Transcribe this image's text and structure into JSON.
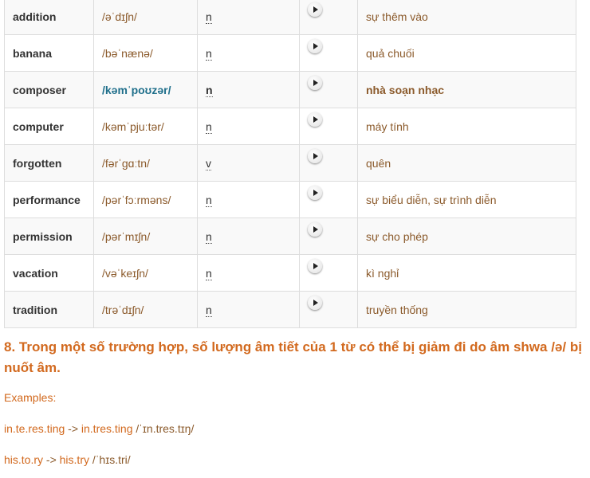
{
  "vocab_rows": [
    {
      "word": "addition",
      "ipa": "/əˈdɪʃn/",
      "pos": "n",
      "meaning": "sự thêm vào"
    },
    {
      "word": "banana",
      "ipa": "/bəˈnænə/",
      "pos": "n",
      "meaning": "quả chuối"
    },
    {
      "word": "composer",
      "ipa": "/kəmˈpoʊzər/",
      "pos": "n",
      "meaning": "nhà soạn nhạc"
    },
    {
      "word": "computer",
      "ipa": "/kəmˈpjuːtər/",
      "pos": "n",
      "meaning": "máy tính"
    },
    {
      "word": "forgotten",
      "ipa": "/fərˈɡɑːtn/",
      "pos": "v",
      "meaning": "quên"
    },
    {
      "word": "performance",
      "ipa": "/pərˈfɔːrməns/",
      "pos": "n",
      "meaning": "sự biểu diễn, sự trình diễn"
    },
    {
      "word": "permission",
      "ipa": "/pərˈmɪʃn/",
      "pos": "n",
      "meaning": "sự cho phép"
    },
    {
      "word": "vacation",
      "ipa": "/vəˈkeɪʃn/",
      "pos": "n",
      "meaning": "kì nghỉ"
    },
    {
      "word": "tradition",
      "ipa": "/trəˈdɪʃn/",
      "pos": "n",
      "meaning": "truyền thống"
    }
  ],
  "icons": {
    "audio": "play-icon"
  },
  "section": {
    "heading": "8. Trong một số trường hợp, số lượng âm tiết của 1 từ có thể bị giảm đi do âm shwa /ə/ bị nuốt âm.",
    "examples_label": "Examples:",
    "examples": [
      {
        "source": "in.te.res.ting",
        "arrow": "->",
        "result": "in.tres.ting",
        "ipa": "/ˈɪn.tres.tɪŋ/"
      },
      {
        "source": "his.to.ry",
        "arrow": "->",
        "result": "his.try",
        "ipa": "/ˈhɪs.tri/"
      }
    ]
  },
  "colors": {
    "accent": "#d2691e",
    "meaning_text": "#8b5a2b",
    "highlight_ipa": "#1f6f8b",
    "border": "#dddddd"
  }
}
